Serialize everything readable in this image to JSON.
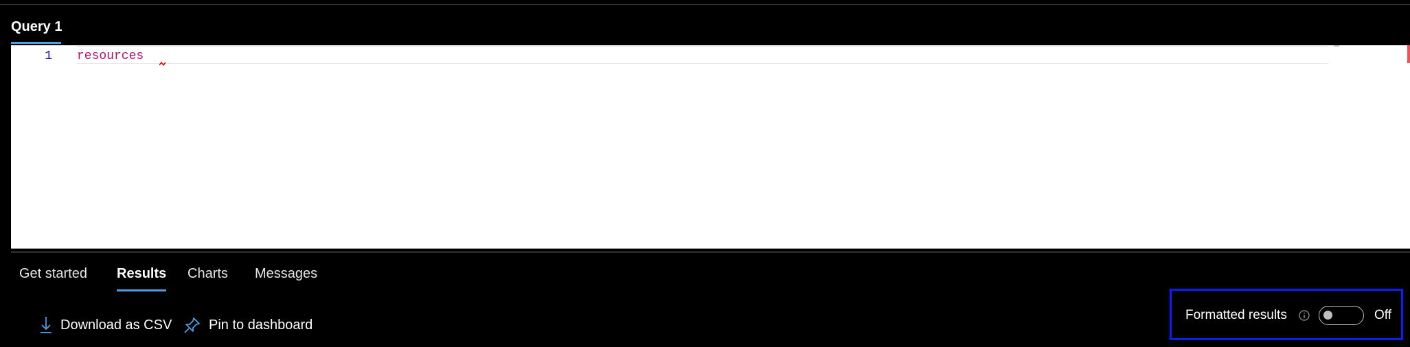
{
  "query_tab": {
    "label": "Query 1"
  },
  "editor": {
    "line_number": "1",
    "code": "resources"
  },
  "result_tabs": [
    {
      "label": "Get started",
      "active": false
    },
    {
      "label": "Results",
      "active": true
    },
    {
      "label": "Charts",
      "active": false
    },
    {
      "label": "Messages",
      "active": false
    }
  ],
  "actions": {
    "download_label": "Download as CSV",
    "download_icon": "download-icon",
    "pin_label": "Pin to dashboard",
    "pin_icon": "pin-icon"
  },
  "formatted_results": {
    "label": "Formatted results",
    "info_icon": "info-icon",
    "toggle_state": "Off",
    "enabled": false
  },
  "colors": {
    "accent": "#4aa0e6",
    "highlight_box": "#0b1cff",
    "keyword": "#b5106f",
    "line_number": "#1a1aa6",
    "background": "#000000"
  }
}
